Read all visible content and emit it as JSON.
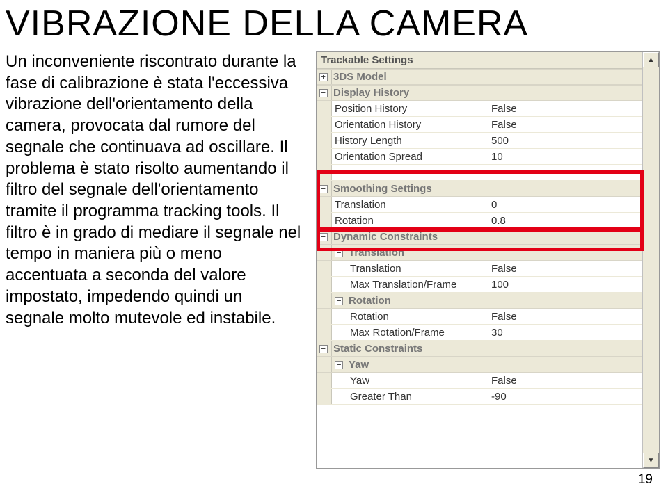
{
  "title": "VIBRAZIONE DELLA CAMERA",
  "body_text": "Un inconveniente riscontrato durante la fase di calibrazione è stata l'eccessiva vibrazione dell'orientamento della camera, provocata dal rumore del segnale che continuava ad oscillare. Il problema è stato risolto aumentando il filtro del segnale dell'orientamento tramite il programma tracking tools. Il filtro è in grado di mediare il segnale nel tempo in maniera più o meno accentuata a seconda del valore impostato, impedendo quindi un segnale molto mutevole ed instabile.",
  "page_number": "19",
  "grid": {
    "header": "Trackable Settings",
    "categories": [
      {
        "expander": "+",
        "label": "3DS Model",
        "props": []
      },
      {
        "expander": "−",
        "label": "Display History",
        "props": [
          {
            "name": "Position History",
            "value": "False"
          },
          {
            "name": "Orientation History",
            "value": "False"
          },
          {
            "name": "History Length",
            "value": "500"
          },
          {
            "name": "Orientation Spread",
            "value": "10"
          },
          {
            "name": "",
            "value": ""
          }
        ]
      },
      {
        "expander": "−",
        "label": "Smoothing Settings",
        "props": [
          {
            "name": "Translation",
            "value": "0"
          },
          {
            "name": "Rotation",
            "value": "0.8"
          }
        ]
      },
      {
        "expander": "−",
        "label": "Dynamic Constraints",
        "props": []
      },
      {
        "expander": "−",
        "label": "Translation",
        "props": [
          {
            "name": "Translation",
            "value": "False"
          },
          {
            "name": "Max Translation/Frame",
            "value": "100"
          }
        ]
      },
      {
        "expander": "−",
        "label": "Rotation",
        "props": [
          {
            "name": "Rotation",
            "value": "False"
          },
          {
            "name": "Max Rotation/Frame",
            "value": "30"
          }
        ]
      },
      {
        "expander": "−",
        "label": "Static Constraints",
        "props": []
      },
      {
        "expander": "−",
        "label": "Yaw",
        "props": [
          {
            "name": "Yaw",
            "value": "False"
          },
          {
            "name": "Greater Than",
            "value": "-90"
          }
        ]
      }
    ]
  }
}
